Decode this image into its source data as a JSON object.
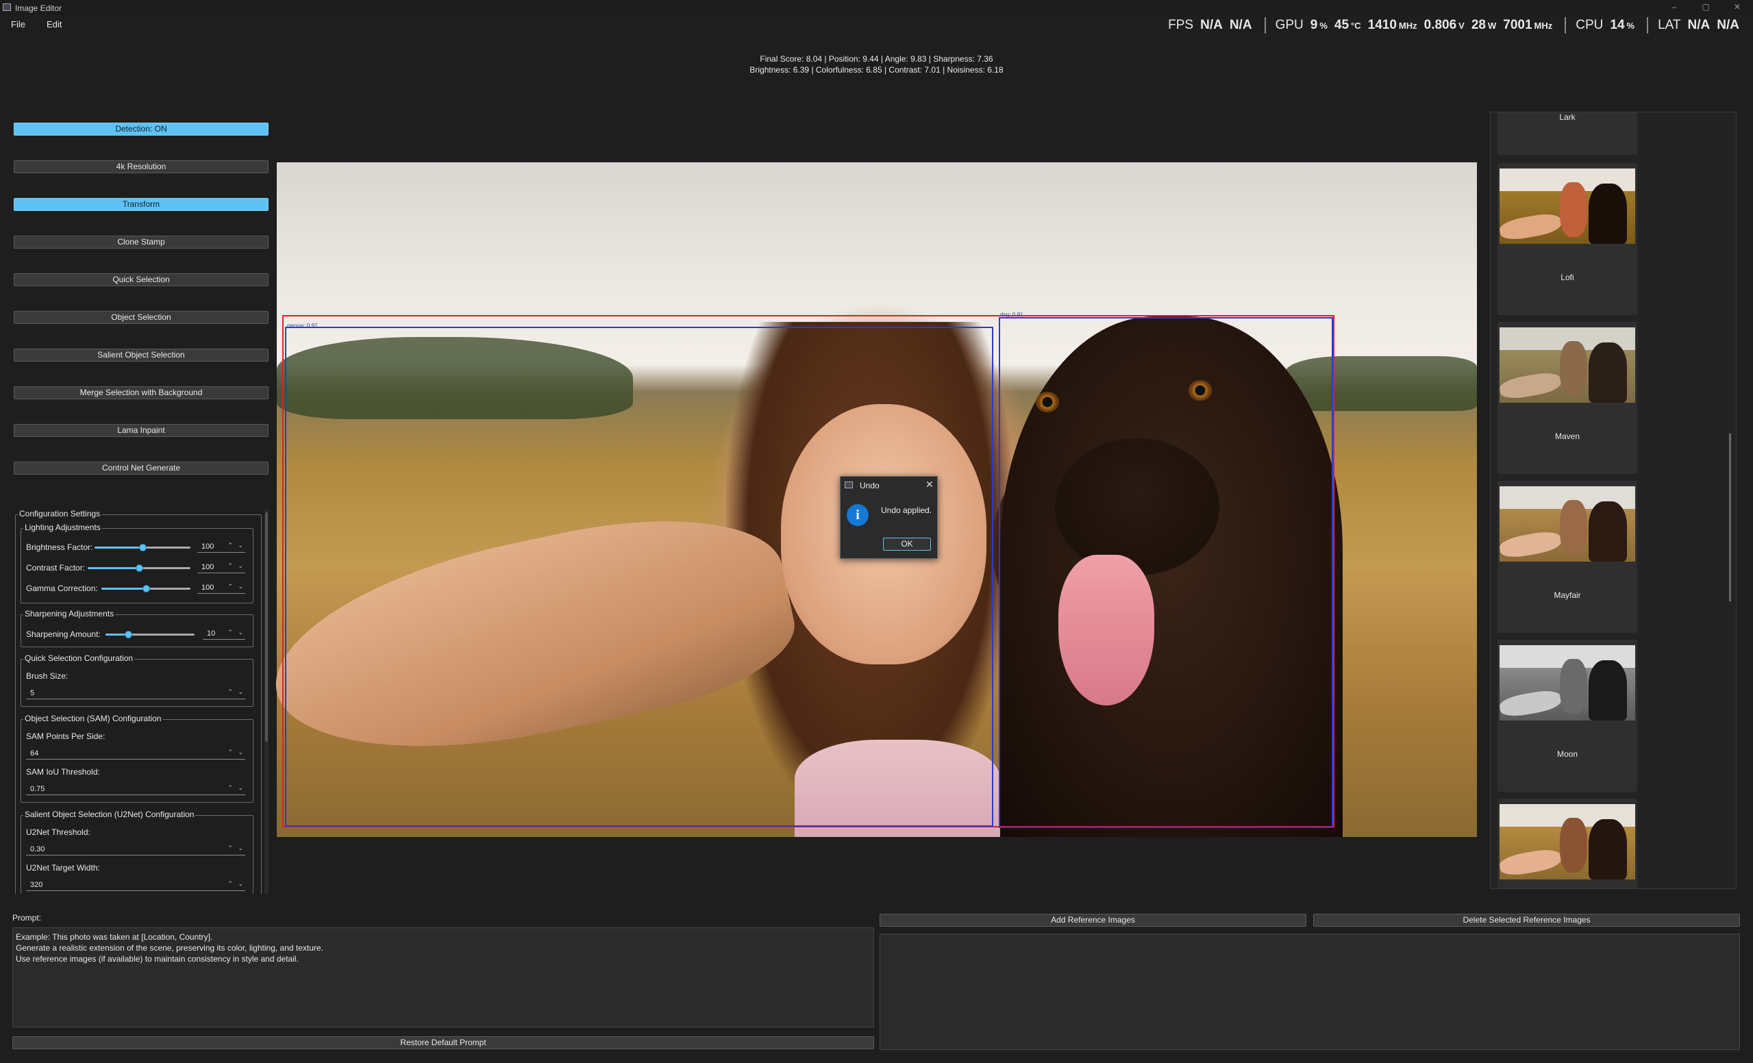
{
  "window": {
    "title": "Image Editor",
    "controls": {
      "minimize": "–",
      "maximize": "▢",
      "close": "✕"
    }
  },
  "menu": {
    "file": "File",
    "edit": "Edit"
  },
  "overlay": {
    "fps_label": "FPS",
    "fps_value1": "N/A",
    "fps_value2": "N/A",
    "gpu_label": "GPU",
    "gpu_usage": "9",
    "gpu_usage_unit": "%",
    "gpu_temp": "45",
    "gpu_temp_unit": "°C",
    "gpu_clock": "1410",
    "gpu_clock_unit": "MHz",
    "gpu_voltage": "0.806",
    "gpu_voltage_unit": "V",
    "gpu_power": "28",
    "gpu_power_unit": "W",
    "mem_clock": "7001",
    "mem_clock_unit": "MHz",
    "cpu_label": "CPU",
    "cpu_usage": "14",
    "cpu_usage_unit": "%",
    "lat_label": "LAT",
    "lat_value1": "N/A",
    "lat_value2": "N/A"
  },
  "score": {
    "line1": "Final Score: 8.04 | Position: 9.44 | Angle: 9.83 | Sharpness: 7.36",
    "line2": "Brightness: 6.39 | Colorfulness: 6.85 | Contrast: 7.01 | Noisiness: 6.18"
  },
  "tools": [
    {
      "label": "Detection: ON",
      "active": true
    },
    {
      "label": "4k Resolution",
      "active": false
    },
    {
      "label": "Transform",
      "active": true
    },
    {
      "label": "Clone Stamp",
      "active": false
    },
    {
      "label": "Quick Selection",
      "active": false
    },
    {
      "label": "Object Selection",
      "active": false
    },
    {
      "label": "Salient Object Selection",
      "active": false
    },
    {
      "label": "Merge Selection with Background",
      "active": false
    },
    {
      "label": "Lama Inpaint",
      "active": false
    },
    {
      "label": "Control Net Generate",
      "active": false
    }
  ],
  "config": {
    "title": "Configuration Settings",
    "lighting": {
      "title": "Lighting Adjustments",
      "brightness": {
        "label": "Brightness Factor:",
        "value": "100",
        "level": 0.5
      },
      "contrast": {
        "label": "Contrast Factor:",
        "value": "100",
        "level": 0.5
      },
      "gamma": {
        "label": "Gamma Correction:",
        "value": "100",
        "level": 0.5
      }
    },
    "sharpening": {
      "title": "Sharpening Adjustments",
      "amount": {
        "label": "Sharpening Amount:",
        "value": "10",
        "level": 0.25
      }
    },
    "quick_selection": {
      "title": "Quick Selection Configuration",
      "brush_label": "Brush Size:",
      "brush_value": "5"
    },
    "sam": {
      "title": "Object Selection (SAM) Configuration",
      "points_label": "SAM Points Per Side:",
      "points_value": "64",
      "iou_label": "SAM IoU Threshold:",
      "iou_value": "0.75"
    },
    "u2net": {
      "title": "Salient Object Selection (U2Net) Configuration",
      "threshold_label": "U2Net Threshold:",
      "threshold_value": "0.30",
      "width_label": "U2Net Target Width:",
      "width_value": "320"
    }
  },
  "detections": [
    {
      "label": "person: 0.97"
    },
    {
      "label": "dog: 0.91"
    }
  ],
  "dialog": {
    "title": "Undo",
    "message": "Undo applied.",
    "ok": "OK",
    "close": "✕",
    "info_glyph": "i"
  },
  "gallery": {
    "items": [
      {
        "label": "Lark",
        "style": "normal"
      },
      {
        "label": "Lofi",
        "style": "vivid"
      },
      {
        "label": "Maven",
        "style": "muted"
      },
      {
        "label": "Mayfair",
        "style": "soft"
      },
      {
        "label": "Moon",
        "style": "bw"
      },
      {
        "label": "",
        "style": "normal"
      }
    ]
  },
  "bottom": {
    "prompt_label": "Prompt:",
    "prompt_text": "Example: This photo was taken at [Location, Country].\nGenerate a realistic extension of the scene, preserving its color, lighting, and texture.\nUse reference images (if available) to maintain consistency in style and detail.",
    "restore_button": "Restore Default Prompt",
    "add_ref_button": "Add Reference Images",
    "delete_ref_button": "Delete Selected Reference Images"
  },
  "colors": {
    "accent": "#5ec2f2",
    "detection_outer": "#e0202a",
    "detection_inner": "#2a3ad0"
  }
}
